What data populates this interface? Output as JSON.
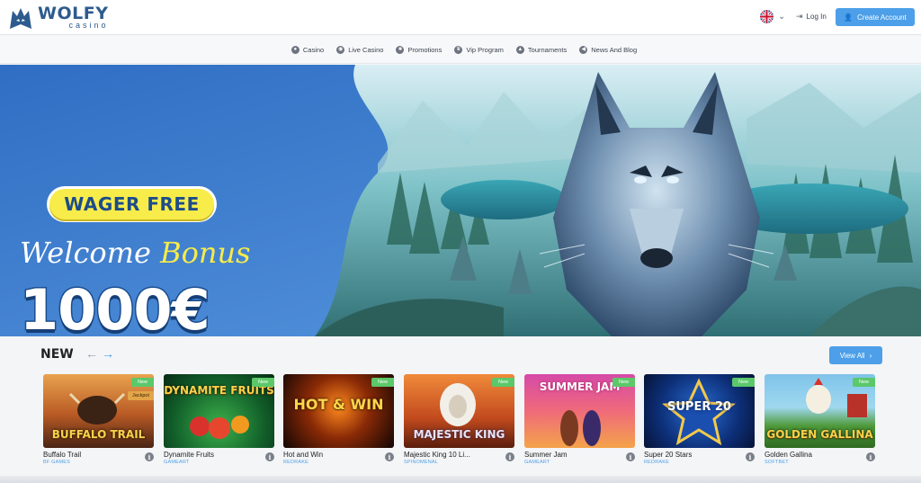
{
  "header": {
    "logo_name": "WOLFY",
    "logo_sub": "casino",
    "login_label": "Log In",
    "create_label": "Create Account"
  },
  "nav": [
    {
      "label": "Casino",
      "icon": "casino-chip-icon"
    },
    {
      "label": "Live Casino",
      "icon": "live-icon"
    },
    {
      "label": "Promotions",
      "icon": "gift-icon"
    },
    {
      "label": "Vip Program",
      "icon": "crown-icon"
    },
    {
      "label": "Tournaments",
      "icon": "trophy-icon"
    },
    {
      "label": "News And Blog",
      "icon": "megaphone-icon"
    }
  ],
  "hero": {
    "badge": "WAGER FREE",
    "welcome_1": "Welcome",
    "welcome_2": "Bonus",
    "amount": "1000€"
  },
  "new_section": {
    "title": "NEW",
    "view_all": "View All",
    "games": [
      {
        "name": "Buffalo Trail",
        "provider": "BF GAMES",
        "tag": "New",
        "tag2": "Jackpot",
        "thumb_title": "BUFFALO TRAIL"
      },
      {
        "name": "Dynamite Fruits",
        "provider": "GAMEART",
        "tag": "New",
        "thumb_title": "DYNAMITE FRUITS"
      },
      {
        "name": "Hot and Win",
        "provider": "REDRAKE",
        "tag": "New",
        "thumb_title": "HOT & WIN"
      },
      {
        "name": "Majestic King 10 Li...",
        "provider": "SPINOMENAL",
        "tag": "New",
        "thumb_title": "MAJESTIC KING"
      },
      {
        "name": "Summer Jam",
        "provider": "GAMEART",
        "tag": "New",
        "thumb_title": "SUMMER JAM"
      },
      {
        "name": "Super 20 Stars",
        "provider": "REDRAKE",
        "tag": "New",
        "thumb_title": "SUPER 20"
      },
      {
        "name": "Golden Gallina",
        "provider": "SOFTBET",
        "tag": "New",
        "thumb_title": "GOLDEN GALLINA"
      }
    ]
  },
  "colors": {
    "accent": "#4c9fe8",
    "brand": "#2d5b8e",
    "new_tag": "#5bc86a",
    "badge": "#f7ec4a"
  }
}
